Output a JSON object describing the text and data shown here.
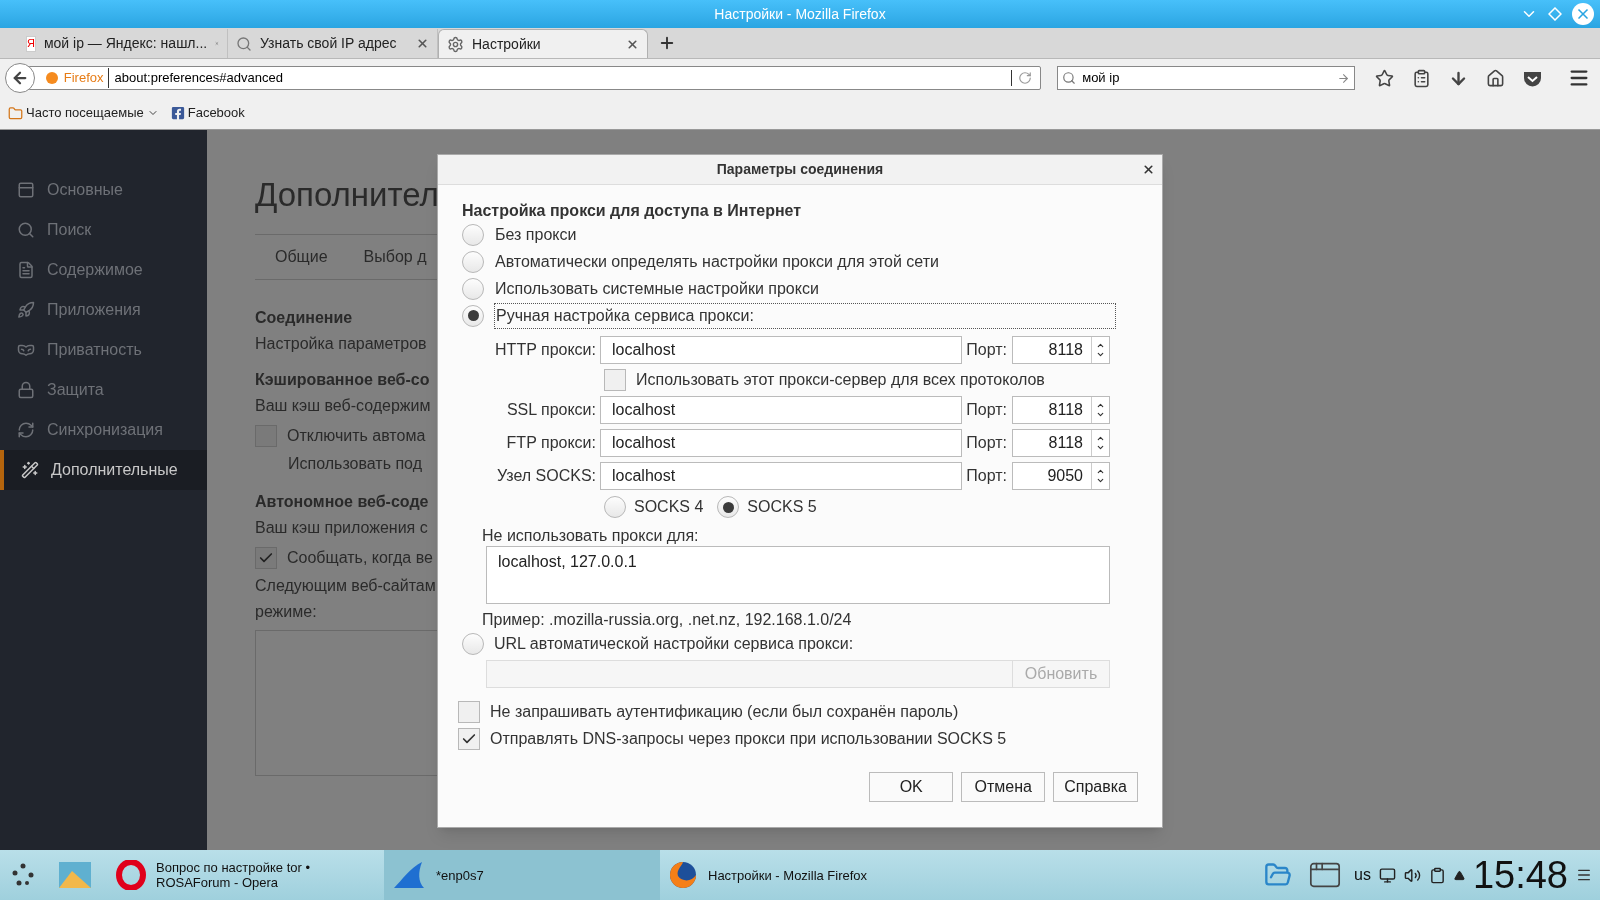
{
  "window": {
    "title": "Настройки - Mozilla Firefox"
  },
  "tabs": [
    {
      "label": "мой ip — Яндекс: нашл...",
      "selected": false,
      "kind": "letter",
      "icon_text": "Я"
    },
    {
      "label": "Узнать свой IP адрес",
      "selected": false,
      "kind": "search"
    },
    {
      "label": "Настройки",
      "selected": true,
      "kind": "gear"
    }
  ],
  "address": {
    "brand": "Firefox",
    "url": "about:preferences#advanced"
  },
  "search": {
    "value": "мой ip"
  },
  "bookmarks": [
    {
      "label": "Часто посещаемые",
      "kind": "folder"
    },
    {
      "label": "Facebook",
      "kind": "facebook"
    }
  ],
  "sidebar": {
    "items": [
      {
        "label": "Основные",
        "selected": false,
        "kind": "general"
      },
      {
        "label": "Поиск",
        "selected": false,
        "kind": "search"
      },
      {
        "label": "Содержимое",
        "selected": false,
        "kind": "content"
      },
      {
        "label": "Приложения",
        "selected": false,
        "kind": "apps"
      },
      {
        "label": "Приватность",
        "selected": false,
        "kind": "privacy"
      },
      {
        "label": "Защита",
        "selected": false,
        "kind": "security"
      },
      {
        "label": "Синхронизация",
        "selected": false,
        "kind": "sync"
      },
      {
        "label": "Дополнительные",
        "selected": true,
        "kind": "advanced"
      }
    ]
  },
  "page": {
    "heading": "Дополнител",
    "tabs": [
      {
        "label": "Общие",
        "selected": false
      },
      {
        "label": "Выбор д",
        "selected": false
      }
    ],
    "blocks": [
      {
        "kind": "heading",
        "text": "Соединение"
      },
      {
        "kind": "text",
        "text": "Настройка параметров"
      },
      {
        "kind": "heading",
        "text": "Кэшированное веб-со"
      },
      {
        "kind": "text",
        "text": "Ваш кэш веб-содержим"
      },
      {
        "kind": "checkbox",
        "text": "Отключить автома",
        "checked": false
      },
      {
        "kind": "subtext",
        "text": "Использовать под"
      },
      {
        "kind": "heading",
        "text": "Автономное веб-соде"
      },
      {
        "kind": "text",
        "text": "Ваш кэш приложения с"
      },
      {
        "kind": "checkbox",
        "text": "Сообщать, когда ве",
        "checked": true
      },
      {
        "kind": "text",
        "text": "Следующим веб-сайтам"
      },
      {
        "kind": "text",
        "text": "режиме:"
      },
      {
        "kind": "listbox"
      }
    ]
  },
  "dialog": {
    "title": "Параметры соединения",
    "heading": "Настройка прокси для доступа в Интернет",
    "modes": [
      {
        "label": "Без прокси",
        "selected": false
      },
      {
        "label": "Автоматически определять настройки прокси для этой сети",
        "selected": false
      },
      {
        "label": "Использовать системные настройки прокси",
        "selected": false
      },
      {
        "label": "Ручная настройка сервиса прокси:",
        "selected": true
      },
      {
        "label": "URL автоматической настройки сервиса прокси:",
        "selected": false
      }
    ],
    "proxies": [
      {
        "label": "HTTP прокси:",
        "value": "localhost",
        "port_label": "Порт:",
        "port": "8118"
      },
      {
        "label": "SSL прокси:",
        "value": "localhost",
        "port_label": "Порт:",
        "port": "8118"
      },
      {
        "label": "FTP прокси:",
        "value": "localhost",
        "port_label": "Порт:",
        "port": "8118"
      },
      {
        "label": "Узел SOCKS:",
        "value": "localhost",
        "port_label": "Порт:",
        "port": "9050"
      }
    ],
    "share_all": {
      "label": "Использовать этот прокси-сервер для всех протоколов",
      "checked": false
    },
    "socks_versions": [
      {
        "label": "SOCKS 4",
        "selected": false
      },
      {
        "label": "SOCKS 5",
        "selected": true
      }
    ],
    "no_proxy": {
      "label": "Не использовать прокси для:",
      "value": "localhost, 127.0.0.1",
      "example": "Пример: .mozilla-russia.org, .net.nz, 192.168.1.0/24"
    },
    "reload_button": {
      "label": "Обновить",
      "disabled": true
    },
    "checkboxes": [
      {
        "label": "Не запрашивать аутентификацию (если был сохранён пароль)",
        "checked": false
      },
      {
        "label": "Отправлять DNS-запросы через прокси при использовании SOCKS 5",
        "checked": true
      }
    ],
    "buttons": [
      "OK",
      "Отмена",
      "Справка"
    ]
  },
  "taskbar": {
    "tasks": [
      {
        "label": "Вопрос по настройке tor • ROSAForum - Opera",
        "kind": "opera"
      },
      {
        "label": "*enp0s7",
        "kind": "shark"
      },
      {
        "label": "Настройки - Mozilla Firefox",
        "kind": "firefox"
      }
    ],
    "layout": "us",
    "clock": "15:48"
  }
}
